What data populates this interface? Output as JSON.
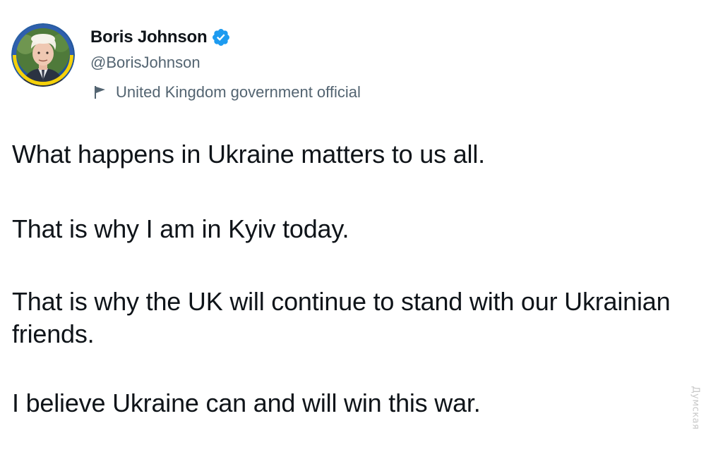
{
  "author": {
    "display_name": "Boris Johnson",
    "handle": "@BorisJohnson",
    "verified_icon": "verified-badge-icon",
    "avatar_icon": "profile-avatar",
    "avatar_ring_color": "#f5d10a",
    "label_icon": "flag-icon",
    "label": "United Kingdom government official"
  },
  "tweet": {
    "paragraphs": [
      "What happens in Ukraine matters to us all.",
      "That is why I am in Kyiv today.",
      "That is why the UK will continue to stand with our Ukrainian friends.",
      "I believe Ukraine can and will win this war."
    ]
  },
  "watermark": {
    "text": "Думская"
  },
  "colors": {
    "text_primary": "#0f1419",
    "text_secondary": "#536471",
    "verified_blue": "#1d9bf0",
    "background": "#ffffff"
  }
}
